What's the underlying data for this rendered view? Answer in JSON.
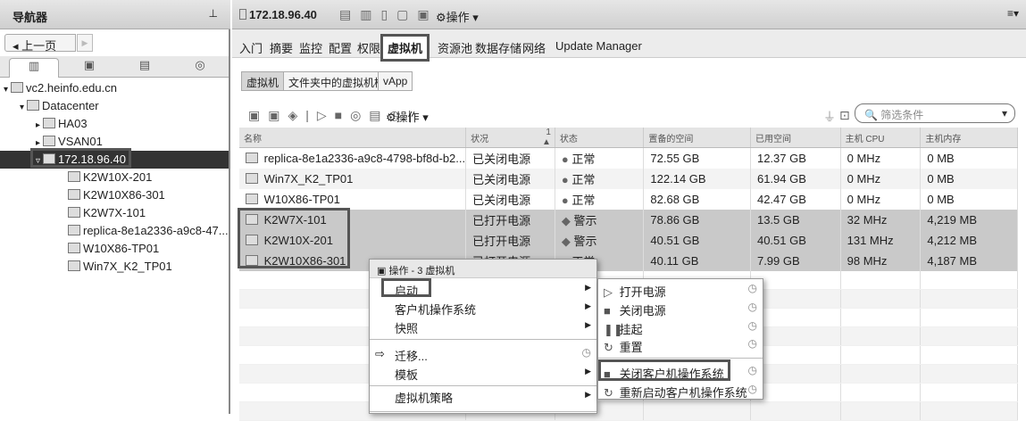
{
  "nav": {
    "title": "导航器",
    "back": "上一页",
    "tree": [
      {
        "label": "vc2.heinfo.edu.cn",
        "level": 0,
        "expander": "▾"
      },
      {
        "label": "Datacenter",
        "level": 1,
        "expander": "▾"
      },
      {
        "label": "HA03",
        "level": 2,
        "expander": "▸"
      },
      {
        "label": "VSAN01",
        "level": 2,
        "expander": "▸"
      },
      {
        "label": "172.18.96.40",
        "level": 2,
        "expander": "▿",
        "selected": true
      },
      {
        "label": "K2W10X-201",
        "level": 4
      },
      {
        "label": "K2W10X86-301",
        "level": 4
      },
      {
        "label": "K2W7X-101",
        "level": 4
      },
      {
        "label": "replica-8e1a2336-a9c8-47...",
        "level": 4
      },
      {
        "label": "W10X86-TP01",
        "level": 4
      },
      {
        "label": "Win7X_K2_TP01",
        "level": 4
      }
    ]
  },
  "header": {
    "host": "172.18.96.40",
    "actions": "操作 ▾"
  },
  "tabs": [
    "入门",
    "摘要",
    "监控",
    "配置",
    "权限",
    "虚拟机",
    "资源池",
    "数据存储",
    "网络",
    "Update Manager"
  ],
  "subtabs": [
    "虚拟机",
    "文件夹中的虚拟机模板",
    "vApp"
  ],
  "toolbar": {
    "actions": "操作 ▾",
    "filter_placeholder": "筛选条件"
  },
  "table": {
    "columns": [
      "名称",
      "状况",
      "1 ▲",
      "状态",
      "置备的空间",
      "已用空间",
      "主机 CPU",
      "主机内存"
    ],
    "rows": [
      [
        "replica-8e1a2336-a9c8-4798-bf8d-b2...",
        "已关闭电源",
        "正常",
        "72.55  GB",
        "12.37  GB",
        "0 MHz",
        "0 MB"
      ],
      [
        "Win7X_K2_TP01",
        "已关闭电源",
        "正常",
        "122.14  GB",
        "61.94  GB",
        "0 MHz",
        "0 MB"
      ],
      [
        "W10X86-TP01",
        "已关闭电源",
        "正常",
        "82.68  GB",
        "42.47  GB",
        "0 MHz",
        "0 MB"
      ],
      [
        "K2W7X-101",
        "已打开电源",
        "警示",
        "78.86  GB",
        "13.5  GB",
        "32 MHz",
        "4,219 MB"
      ],
      [
        "K2W10X-201",
        "已打开电源",
        "警示",
        "40.51  GB",
        "40.51  GB",
        "131 MHz",
        "4,212 MB"
      ],
      [
        "K2W10X86-301",
        "已打开电源",
        "正常",
        "40.11  GB",
        "7.99  GB",
        "98 MHz",
        "4,187 MB"
      ]
    ]
  },
  "context_menu": {
    "title": "操作 - 3 虚拟机",
    "items": [
      "启动",
      "客户机操作系统",
      "快照",
      "迁移...",
      "模板",
      "虚拟机策略"
    ]
  },
  "submenu": {
    "items": [
      "打开电源",
      "关闭电源",
      "挂起",
      "重置",
      "关闭客户机操作系统",
      "重新启动客户机操作系统"
    ]
  }
}
